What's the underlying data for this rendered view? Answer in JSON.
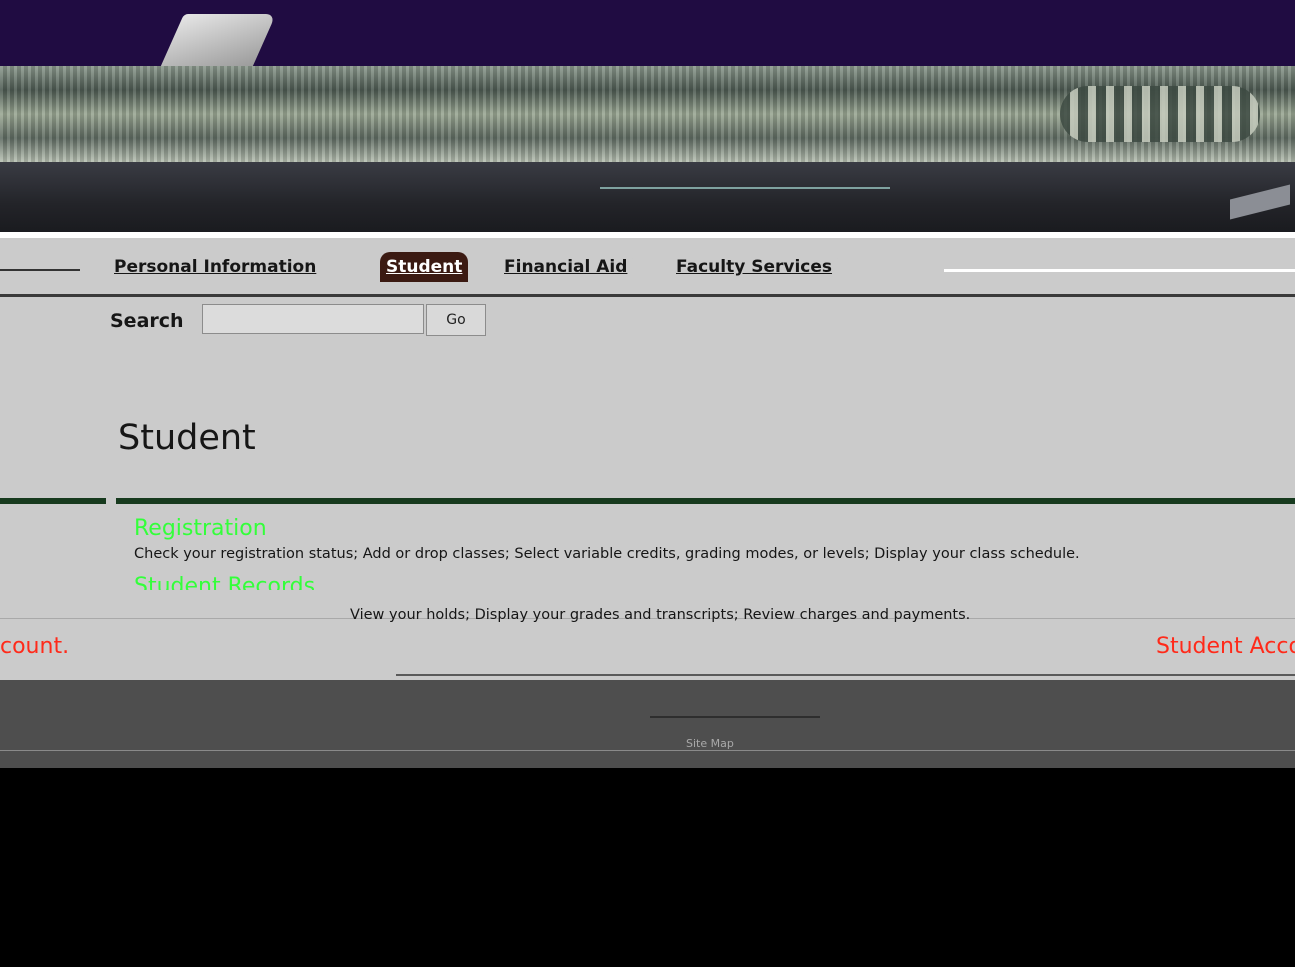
{
  "tabs": [
    {
      "label": "Personal Information",
      "active": false
    },
    {
      "label": "Student",
      "active": true
    },
    {
      "label": "Financial Aid",
      "active": false
    },
    {
      "label": "Faculty Services",
      "active": false
    }
  ],
  "search": {
    "label": "Search",
    "value": "",
    "go_label": "Go"
  },
  "page_title": "Student",
  "menu": [
    {
      "label": "Registration",
      "description": "Check your registration status; Add or drop classes; Select variable credits, grading modes, or levels; Display your class schedule."
    },
    {
      "label": "Student Records",
      "description": "View your holds; Display your grades and transcripts; Review charges and payments."
    },
    {
      "label": "Student Account",
      "left_fragment": "count."
    }
  ],
  "footer": {
    "site_map": "Site Map"
  },
  "colors": {
    "header": "#200c42",
    "active_tab": "#3b1a12",
    "menu_link": "#33ff3a",
    "account_link": "#ff2a1a",
    "rule": "#173a1e",
    "content_bg": "#cbcbcb"
  }
}
